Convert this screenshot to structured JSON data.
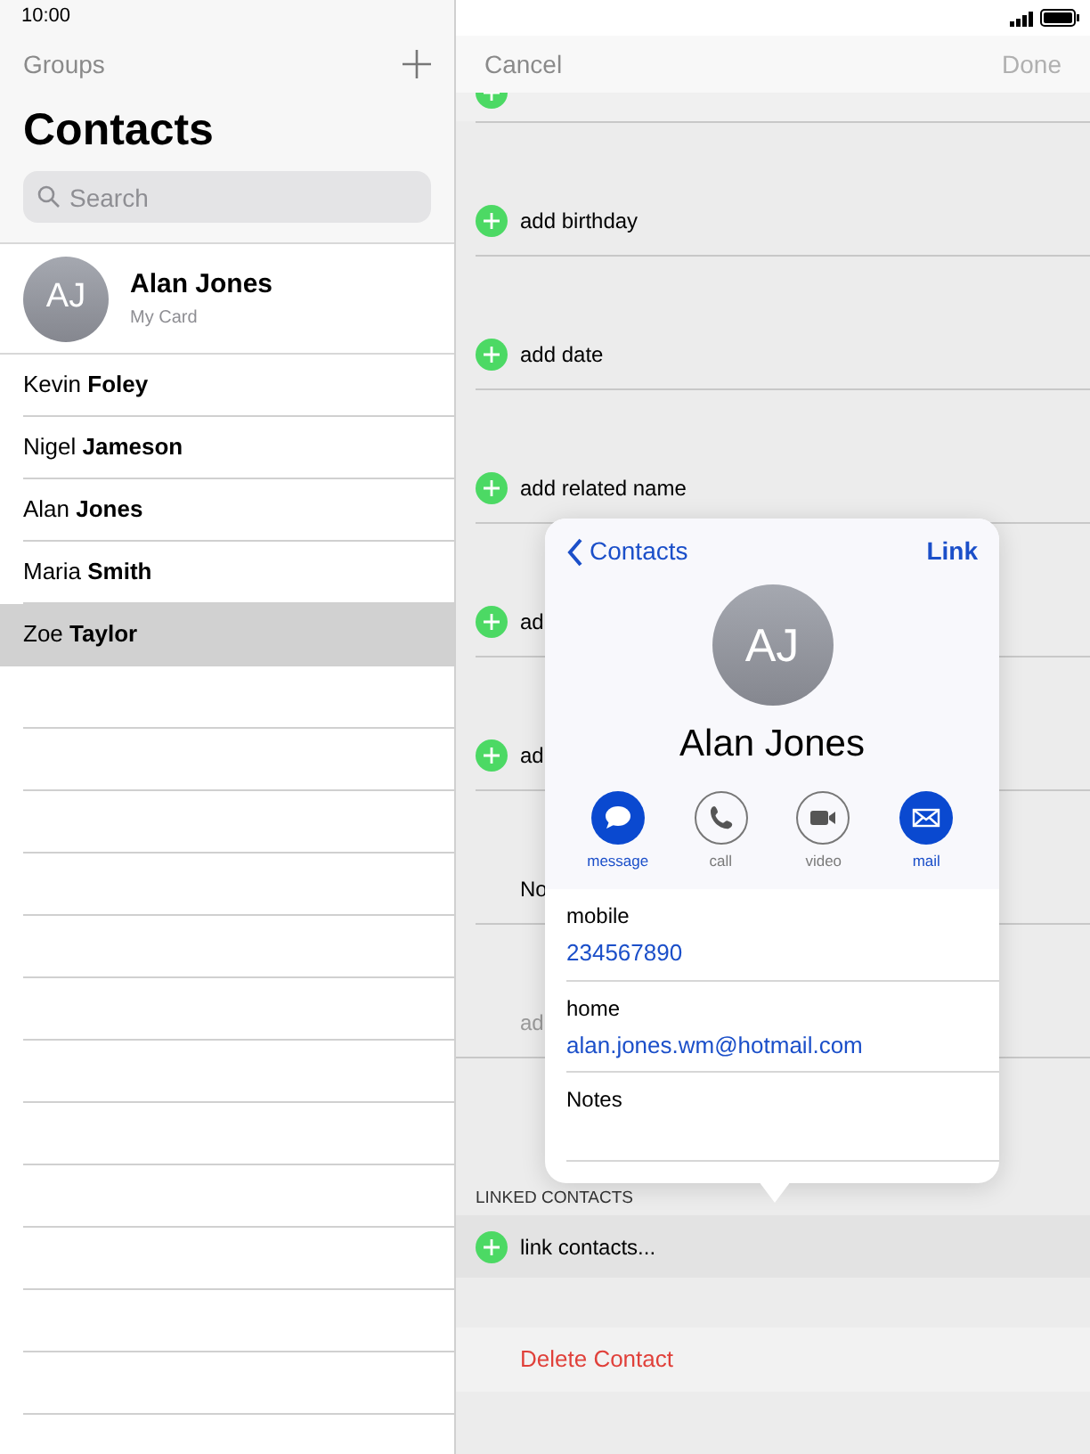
{
  "status_bar": {
    "time": "10:00"
  },
  "sidebar": {
    "groups_button": "Groups",
    "title": "Contacts",
    "search": {
      "placeholder": "Search"
    },
    "my_card": {
      "initials": "AJ",
      "name": "Alan Jones",
      "subtitle": "My Card"
    },
    "contacts": [
      {
        "name": "Kevin **Foley**",
        "selected": false
      },
      {
        "name": "Nigel **Jameson**",
        "selected": false
      },
      {
        "name": "Alan **Jones**",
        "selected": false
      },
      {
        "name": "Maria **Smith**",
        "selected": false
      },
      {
        "name": "Zoe **Taylor**",
        "selected": true
      }
    ]
  },
  "editor": {
    "cancel": "Cancel",
    "done": {
      "label": "Done",
      "disabled": true
    },
    "rows": [
      {
        "kind": "add",
        "label": "add birthday"
      },
      {
        "kind": "add",
        "label": "add date"
      },
      {
        "kind": "add",
        "label": "add related name"
      },
      {
        "kind": "add",
        "label": "ad"
      },
      {
        "kind": "add",
        "label": "ad"
      },
      {
        "kind": "plain",
        "label": "No"
      },
      {
        "kind": "placeholder",
        "label": "ad"
      }
    ],
    "linked_header": "LINKED CONTACTS",
    "link_row": "link contacts...",
    "delete": "Delete Contact"
  },
  "popover": {
    "back": "Contacts",
    "link": "Link",
    "initials": "AJ",
    "name": "Alan Jones",
    "actions": [
      {
        "kind": "message",
        "label": "message",
        "enabled": true
      },
      {
        "kind": "call",
        "label": "call",
        "enabled": false
      },
      {
        "kind": "video",
        "label": "video",
        "enabled": false
      },
      {
        "kind": "mail",
        "label": "mail",
        "enabled": true
      }
    ],
    "fields": [
      {
        "label": "mobile",
        "value": "234567890"
      },
      {
        "label": "home",
        "value": "alan.jones.wm@hotmail.com"
      },
      {
        "label": "Notes"
      }
    ]
  }
}
